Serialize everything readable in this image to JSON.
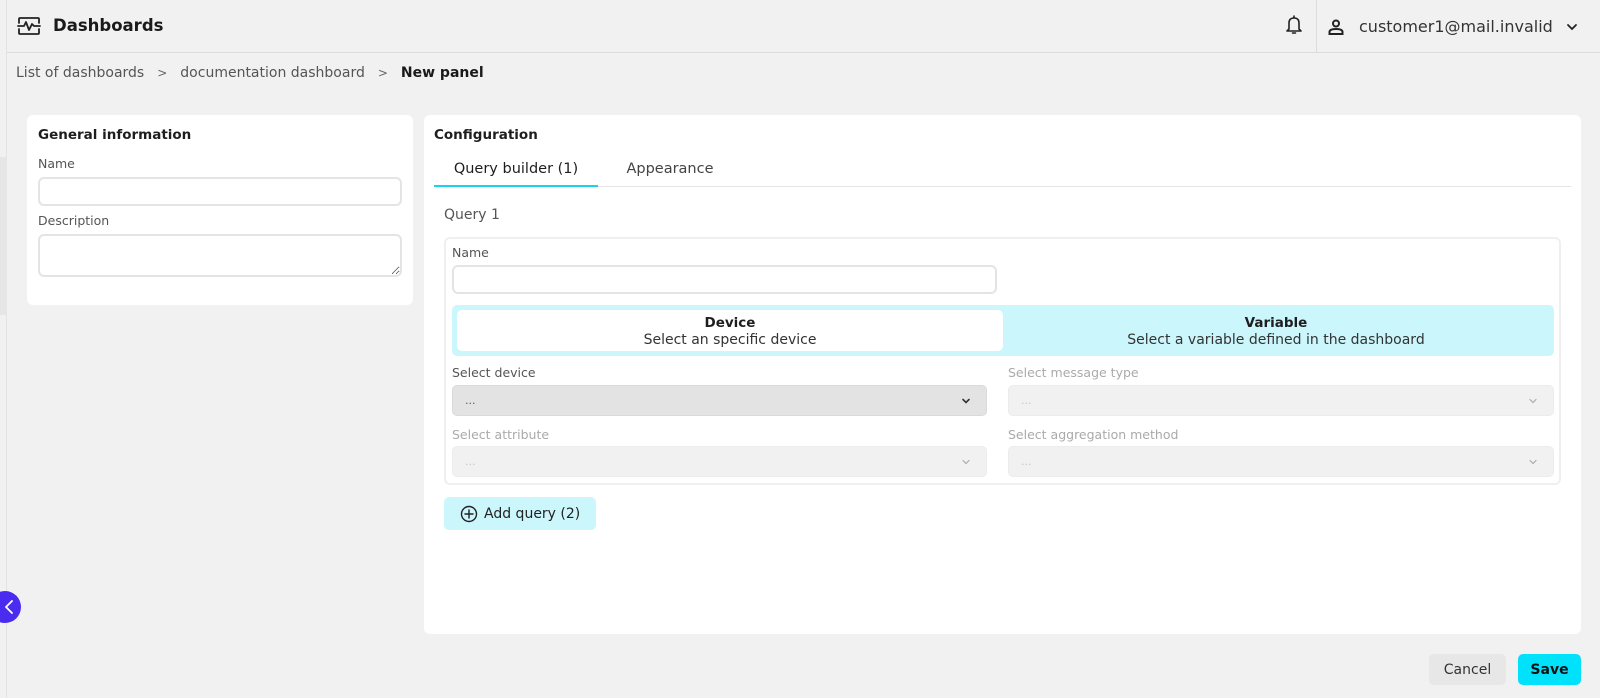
{
  "header": {
    "app_title": "Dashboards",
    "app_icon": "dashboard-pulse-icon",
    "notifications_icon": "bell-icon",
    "user": {
      "icon": "user-icon",
      "email": "customer1@mail.invalid",
      "menu_icon": "chevron-down-icon"
    }
  },
  "breadcrumb": {
    "items": [
      "List of dashboards",
      "documentation dashboard",
      "New panel"
    ],
    "separator": ">"
  },
  "general_information": {
    "title": "General information",
    "name_label": "Name",
    "name_value": "",
    "description_label": "Description",
    "description_value": ""
  },
  "configuration": {
    "title": "Configuration",
    "tabs": [
      {
        "label": "Query builder (1)",
        "active": true
      },
      {
        "label": "Appearance",
        "active": false
      }
    ],
    "query": {
      "title": "Query 1",
      "name_label": "Name",
      "name_value": "",
      "source_options": [
        {
          "title": "Device",
          "subtitle": "Select an specific device",
          "selected": true
        },
        {
          "title": "Variable",
          "subtitle": "Select a variable defined in the dashboard",
          "selected": false
        }
      ],
      "selects": [
        {
          "label": "Select device",
          "value": "...",
          "enabled": true
        },
        {
          "label": "Select message type",
          "value": "...",
          "enabled": false
        },
        {
          "label": "Select attribute",
          "value": "...",
          "enabled": false
        },
        {
          "label": "Select aggregation method",
          "value": "...",
          "enabled": false
        }
      ]
    },
    "add_query_label": "Add query (2)",
    "add_query_icon": "plus-circle-icon"
  },
  "footer": {
    "cancel_label": "Cancel",
    "save_label": "Save"
  },
  "sidebar_toggle_icon": "chevron-left-icon",
  "colors": {
    "accent": "#00e1fb",
    "accent_light": "#cbf6fc",
    "tab_underline": "#19d3ec",
    "collapse_button": "#4a2cf0",
    "background": "#f1f1f1"
  }
}
